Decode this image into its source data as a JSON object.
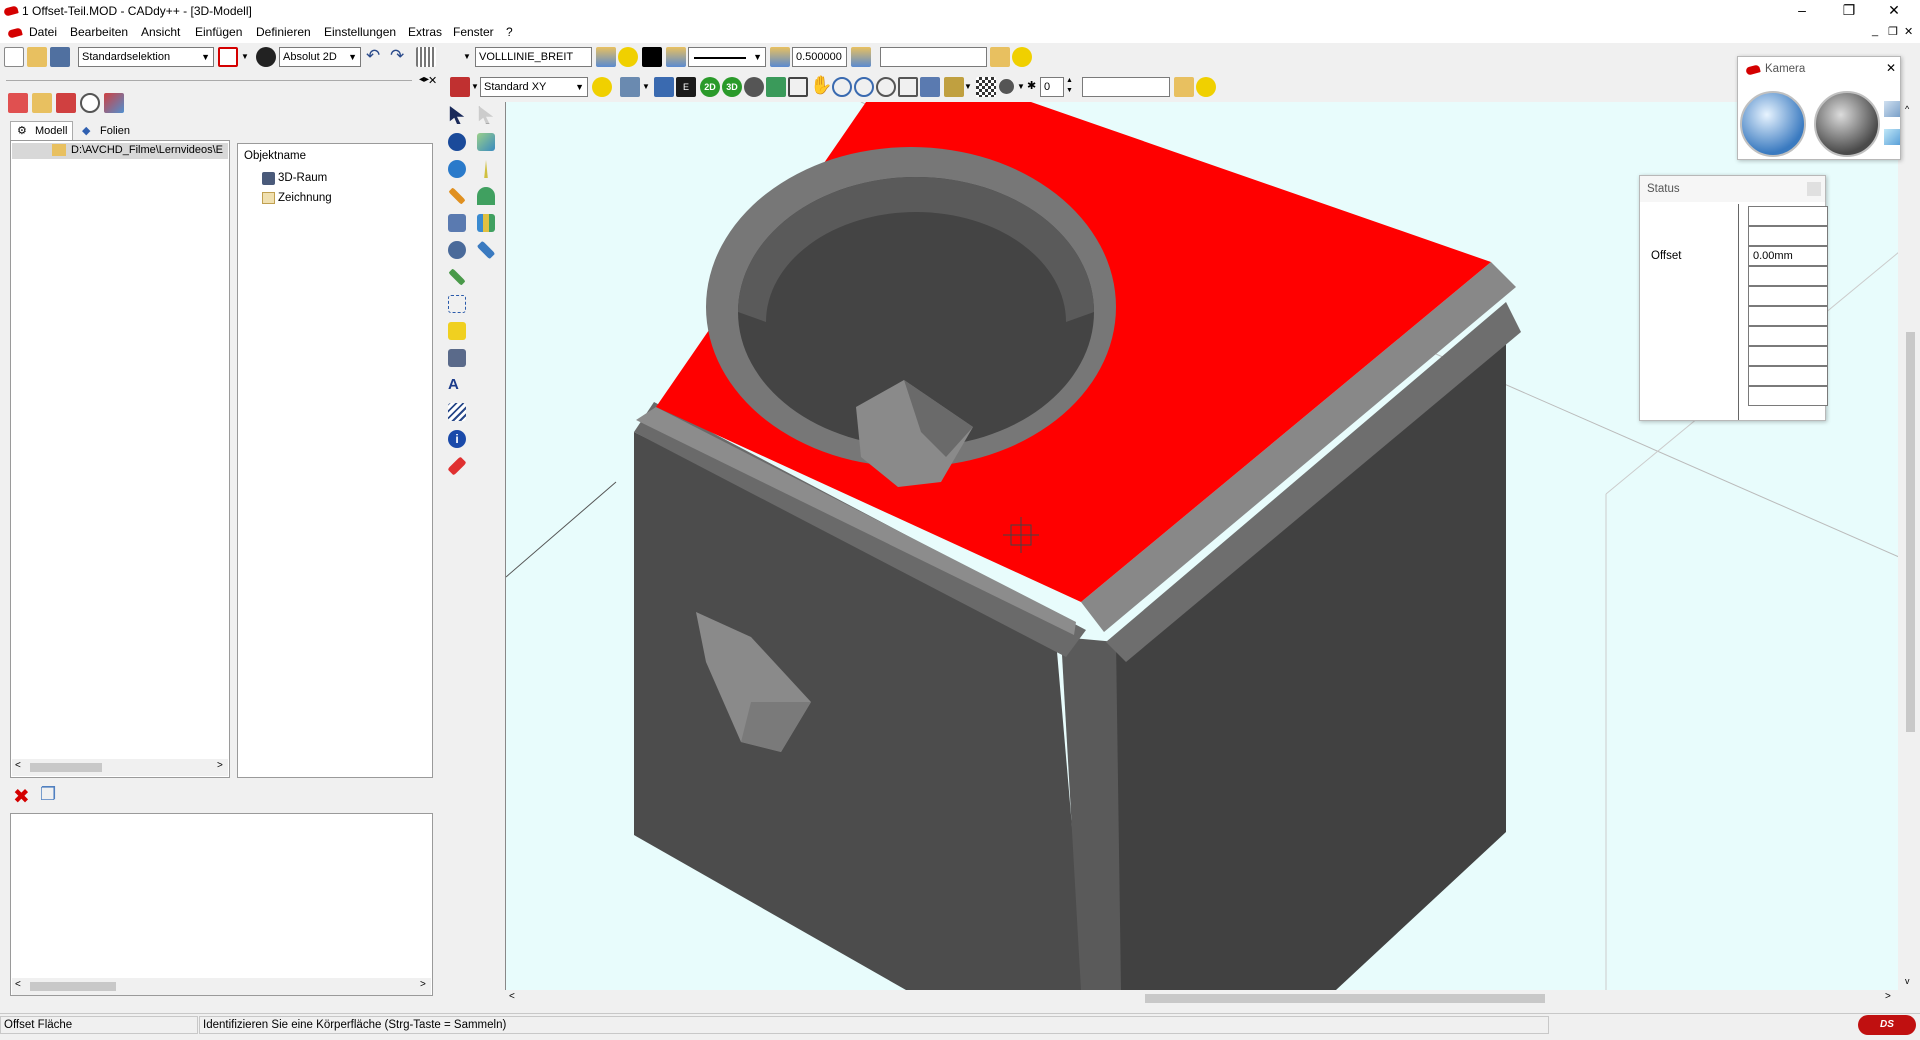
{
  "window": {
    "title": "1 Offset-Teil.MOD  -  CADdy++ - [3D-Modell]",
    "minimize": "–",
    "restore": "❐",
    "close": "✕"
  },
  "menu": [
    "Datei",
    "Bearbeiten",
    "Ansicht",
    "Einfügen",
    "Definieren",
    "Einstellungen",
    "Extras",
    "Fenster",
    "?"
  ],
  "toolbar1": {
    "selection_mode": "Standardselektion",
    "coordinate_mode": "Absolut 2D",
    "line_type": "VOLLLINIE_BREIT",
    "line_width": "0.500000",
    "empty_field": ""
  },
  "toolbar2": {
    "view": "Standard XY",
    "view_2d": "2D",
    "view_3d": "3D",
    "counter": "0",
    "empty_field": ""
  },
  "left_panel": {
    "tabs": [
      "Modell",
      "Folien"
    ],
    "tree_path": "D:\\AVCHD_Filme\\Lernvideos\\E",
    "objects_header": "Objektname",
    "objects": [
      "3D-Raum",
      "Zeichnung"
    ]
  },
  "camera_window": {
    "title": "Kamera"
  },
  "status_window": {
    "title": "Status",
    "offset_label": "Offset",
    "offset_value": "0.00mm"
  },
  "statusbar": {
    "command": "Offset Fläche",
    "prompt": "Identifizieren Sie eine Körperfläche (Strg-Taste = Sammeln)"
  },
  "colors": {
    "selected_face": "#ff0000",
    "viewport_bg": "#e8fcfc",
    "model_gray": "#4a4a4a",
    "brand": "#d40000"
  }
}
